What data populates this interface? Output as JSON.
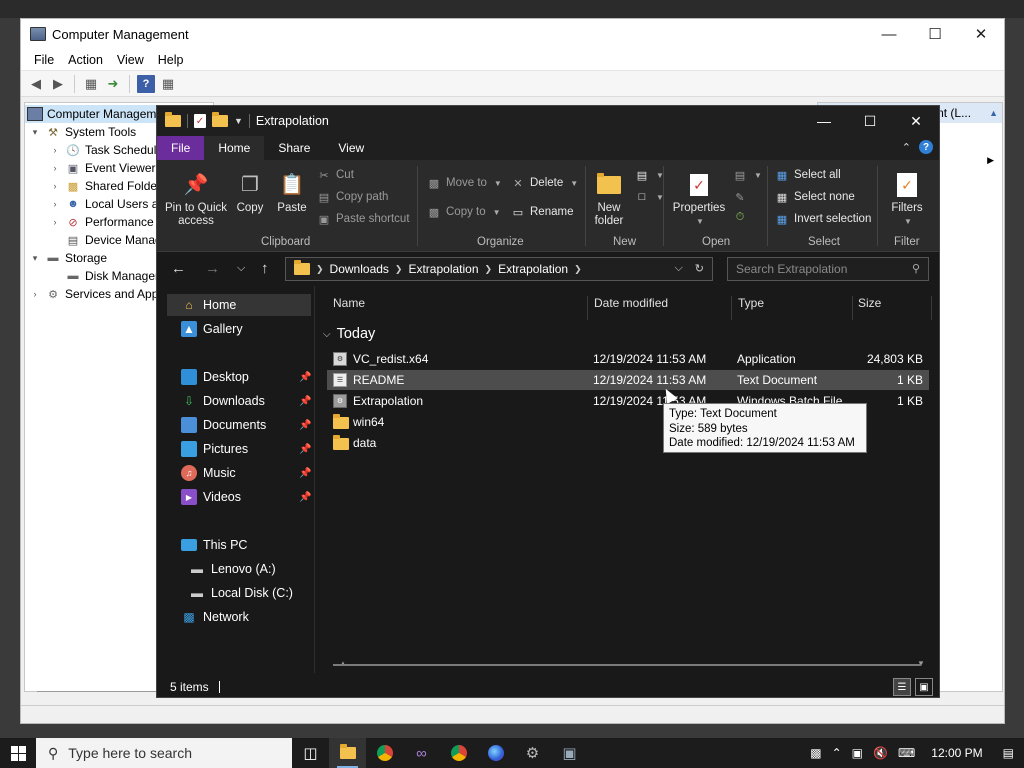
{
  "computer_management": {
    "title": "Computer Management",
    "caption_buttons": {
      "minimize": "—",
      "maximize": "☐",
      "close": "✕"
    },
    "menu": [
      "File",
      "Action",
      "View",
      "Help"
    ],
    "tree": [
      {
        "label": "Computer Managem",
        "level": 0,
        "expander": ""
      },
      {
        "label": "System Tools",
        "level": 1,
        "expander": "▾"
      },
      {
        "label": "Task Schedule",
        "level": 2,
        "expander": "›"
      },
      {
        "label": "Event Viewer",
        "level": 2,
        "expander": "›"
      },
      {
        "label": "Shared Folder",
        "level": 2,
        "expander": "›"
      },
      {
        "label": "Local Users ar",
        "level": 2,
        "expander": "›"
      },
      {
        "label": "Performance",
        "level": 2,
        "expander": "›"
      },
      {
        "label": "Device Manag",
        "level": 2,
        "expander": ""
      },
      {
        "label": "Storage",
        "level": 1,
        "expander": "▾"
      },
      {
        "label": "Disk Manager",
        "level": 2,
        "expander": ""
      },
      {
        "label": "Services and App",
        "level": 1,
        "expander": "›"
      }
    ],
    "right_header": "nt (L..."
  },
  "explorer": {
    "title": "Extrapolation",
    "caption_buttons": {
      "minimize": "—",
      "maximize": "☐",
      "close": "✕"
    },
    "ribbon_tabs": [
      "File",
      "Home",
      "Share",
      "View"
    ],
    "ribbon": {
      "clipboard": {
        "label": "Clipboard",
        "pin": "Pin to Quick access",
        "copy": "Copy",
        "paste": "Paste",
        "cut": "Cut",
        "copy_path": "Copy path",
        "paste_shortcut": "Paste shortcut"
      },
      "organize": {
        "label": "Organize",
        "move_to": "Move to",
        "copy_to": "Copy to",
        "delete": "Delete",
        "rename": "Rename"
      },
      "new": {
        "label": "New",
        "new_folder": "New folder"
      },
      "open": {
        "label": "Open",
        "properties": "Properties"
      },
      "select": {
        "label": "Select",
        "select_all": "Select all",
        "select_none": "Select none",
        "invert": "Invert selection"
      },
      "filter": {
        "label": "Filter",
        "filters": "Filters"
      }
    },
    "address": {
      "crumbs": [
        "Downloads",
        "Extrapolation",
        "Extrapolation"
      ],
      "search_placeholder": "Search Extrapolation"
    },
    "nav_pane": {
      "home": "Home",
      "gallery": "Gallery",
      "pinned": [
        "Desktop",
        "Downloads",
        "Documents",
        "Pictures",
        "Music",
        "Videos"
      ],
      "this_pc": "This PC",
      "drives": [
        "Lenovo (A:)",
        "Local Disk (C:)"
      ],
      "network": "Network"
    },
    "columns": {
      "name": "Name",
      "date": "Date modified",
      "type": "Type",
      "size": "Size"
    },
    "group": "Today",
    "files": [
      {
        "name": "VC_redist.x64",
        "date": "12/19/2024 11:53 AM",
        "type": "Application",
        "size": "24,803 KB",
        "icon": "app"
      },
      {
        "name": "README",
        "date": "12/19/2024 11:53 AM",
        "type": "Text Document",
        "size": "1 KB",
        "icon": "doc"
      },
      {
        "name": "Extrapolation",
        "date": "12/19/2024 11:53 AM",
        "type": "Windows Batch File",
        "size": "1 KB",
        "icon": "bat"
      },
      {
        "name": "win64",
        "date": "",
        "type": "File folder",
        "size": "",
        "icon": "folder"
      },
      {
        "name": "data",
        "date": "",
        "type": "File folder",
        "size": "",
        "icon": "folder"
      }
    ],
    "tooltip": {
      "type": "Type: Text Document",
      "size": "Size: 589 bytes",
      "date": "Date modified: 12/19/2024 11:53 AM"
    },
    "status": "5 items"
  },
  "taskbar": {
    "search_placeholder": "Type here to search",
    "clock": "12:00 PM"
  },
  "colors": {
    "file_tab": "#6c2d9c",
    "explorer_bg": "#191919",
    "ribbon_bg": "#2b2b2b",
    "folder": "#f2c14e",
    "taskbar": "#1c1c1c"
  }
}
